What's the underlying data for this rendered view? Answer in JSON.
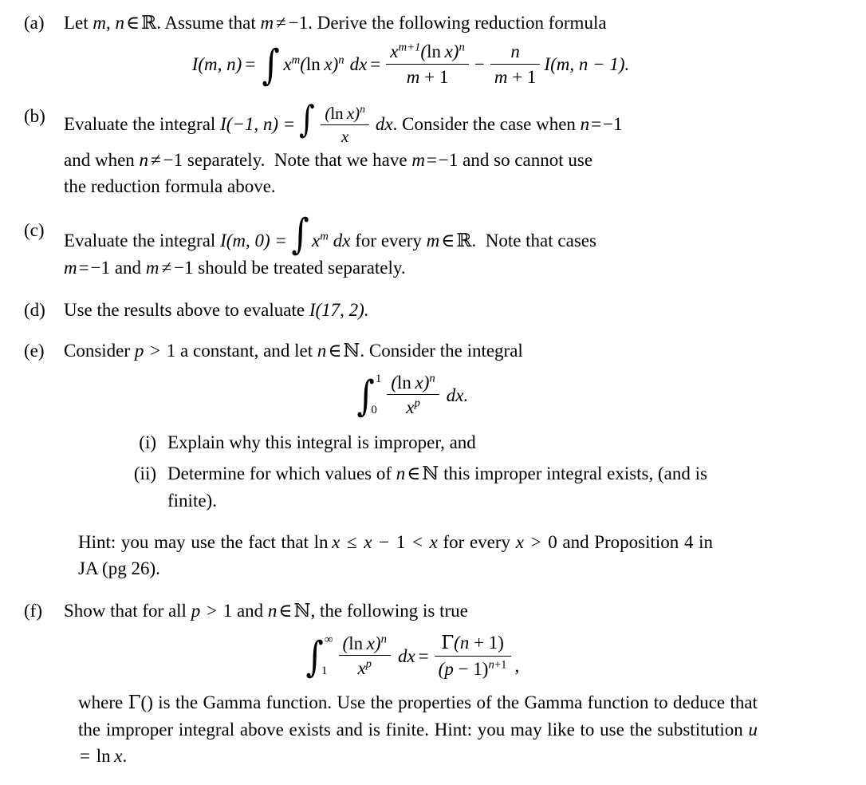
{
  "document": {
    "type": "math-problem-set",
    "items": [
      {
        "label": "(a)",
        "text_before": "Let ",
        "text_mid": ". Assume that ",
        "text_after": ". Derive the following reduction formula",
        "vars": "m, n",
        "set": "ℝ",
        "condition_lhs": "m",
        "condition_rhs": "−1",
        "equation": {
          "lhs": "I(m, n)",
          "integrand": "x^m (ln x)^n dx",
          "num1": "x^{m+1}(ln x)^n",
          "den1": "m + 1",
          "coef_num": "n",
          "coef_den": "m + 1",
          "tail": "I(m, n − 1)."
        }
      },
      {
        "label": "(b)",
        "line1_a": "Evaluate the integral ",
        "line1_fn": "I(−1, n) =",
        "frac_num": "(ln x)^n",
        "frac_den": "x",
        "line1_b": "dx. Consider the case when ",
        "line1_c": "n = −1",
        "line2": "and when n ≠ −1 separately. Note that we have m = −1 and so cannot use",
        "line3": "the reduction formula above."
      },
      {
        "label": "(c)",
        "line1_a": "Evaluate the integral ",
        "line1_fn": "I(m, 0) =",
        "integrand": "x^m dx",
        "line1_b": " for every ",
        "line1_set": "m ∈ ℝ",
        "line1_c": ". Note that cases",
        "line2": "m = −1 and m ≠ −1 should be treated separately."
      },
      {
        "label": "(d)",
        "text": "Use the results above to evaluate ",
        "fn": "I(17, 2)."
      },
      {
        "label": "(e)",
        "intro_a": "Consider ",
        "intro_p": "p > 1",
        "intro_b": " a constant, and let ",
        "intro_n": "n ∈ ℕ",
        "intro_c": ". Consider the integral",
        "equation": {
          "upper": "1",
          "lower": "0",
          "num": "(ln x)^n",
          "den": "x^p",
          "dx": "dx."
        },
        "subitems": [
          {
            "label": "(i)",
            "text": "Explain why this integral is improper, and"
          },
          {
            "label": "(ii)",
            "text_a": "Determine for which values of ",
            "text_n": "n ∈ ℕ",
            "text_b": " this improper integral exists, (and is finite)."
          }
        ],
        "hint_a": "Hint:  you may use the fact that ",
        "hint_math": "ln x ≤ x − 1 < x",
        "hint_b": " for every ",
        "hint_x": "x > 0",
        "hint_c": " and Proposition 4 in JA (pg 26)."
      },
      {
        "label": "(f)",
        "intro_a": "Show that for all ",
        "intro_p": "p > 1",
        "intro_b": " and ",
        "intro_n": "n ∈ ℕ",
        "intro_c": ", the following is true",
        "equation": {
          "upper": "∞",
          "lower": "1",
          "num": "(ln x)^n",
          "den": "x^p",
          "dx": "dx",
          "eq": "=",
          "rhs_num": "Γ(n + 1)",
          "rhs_den": "(p − 1)^{n+1}",
          "rhs_tail": ","
        },
        "closing_a": "where ",
        "closing_gamma": "Γ()",
        "closing_b": " is the Gamma function.  Use the properties of the Gamma function to deduce that the improper integral above exists and is finite.  Hint: you may like to use the substitution ",
        "closing_sub": "u = ln x",
        "closing_c": "."
      }
    ]
  },
  "glyphs": {
    "integral": "∫",
    "reals": "ℝ",
    "naturals": "ℕ",
    "gamma": "Γ",
    "infinity": "∞",
    "not_equal": "≠",
    "element_of": "∈",
    "leq": "≤",
    "minus": "−"
  },
  "colors": {
    "text": "#000000",
    "background": "#ffffff"
  }
}
